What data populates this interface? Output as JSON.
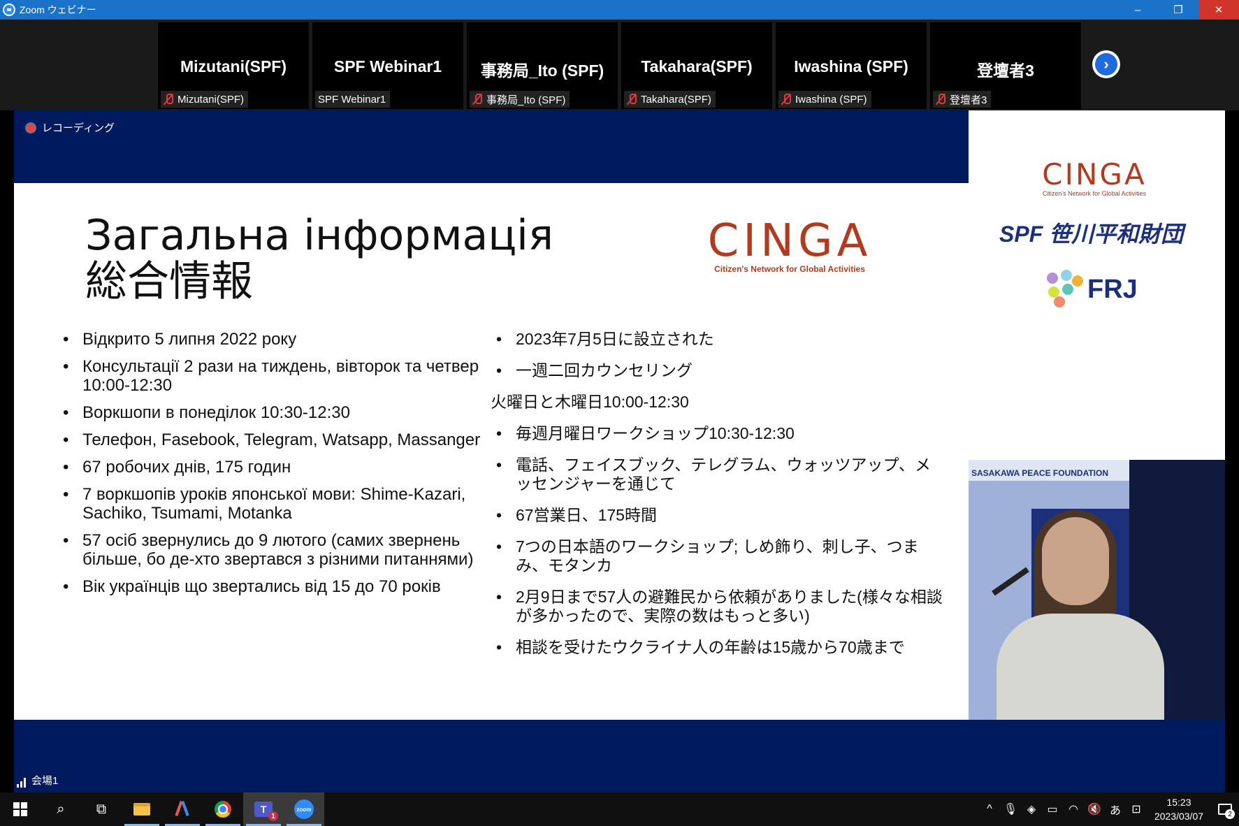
{
  "window": {
    "title": "Zoom ウェビナー",
    "minimize": "–",
    "restore": "❐",
    "close": "✕"
  },
  "participants": [
    {
      "name": "Mizutani(SPF)",
      "label": "Mizutani(SPF)",
      "muted": true
    },
    {
      "name": "SPF Webinar1",
      "label": "SPF Webinar1",
      "muted": false
    },
    {
      "name": "事務局_Ito (SPF)",
      "label": "事務局_Ito (SPF)",
      "muted": true
    },
    {
      "name": "Takahara(SPF)",
      "label": "Takahara(SPF)",
      "muted": true
    },
    {
      "name": "Iwashina (SPF)",
      "label": "Iwashina (SPF)",
      "muted": true
    },
    {
      "name": "登壇者3",
      "label": "登壇者3",
      "muted": true
    }
  ],
  "next_page": "›",
  "recording": "レコーディング",
  "slide": {
    "title_ua": "Загальна інформація",
    "title_jp": "総合情報",
    "logo": "CINGA",
    "logo_sub": "Citizen's Network for Global Activities",
    "left_bullets": [
      "Відкрито 5 липня 2022 року",
      "Консультації 2 рази на тиждень, вівторок та четвер 10:00-12:30",
      "Воркшопи в понеділок 10:30-12:30",
      "Телефон, Fasebook, Telegram, Watsapp, Massanger",
      "67 робочих днів, 175 годин",
      "7 воркшопів уроків японської мови: Shime-Kazari, Sachiko, Tsumami, Motanka",
      "57 осіб звернулись до 9 лютого (самих звернень більше, бо де-хто звертався з різними питаннями)",
      "Вік українців що звертались від 15 до 70 років"
    ],
    "right_items": [
      {
        "text": "2023年7月5日に設立された",
        "bullet": true
      },
      {
        "text": "一週二回カウンセリング",
        "bullet": true
      },
      {
        "text": "火曜日と木曜日10:00-12:30",
        "bullet": false
      },
      {
        "text": "毎週月曜日ワークショップ10:30-12:30",
        "bullet": true
      },
      {
        "text": "電話、フェイスブック、テレグラム、ウォッツアップ、メッセンジャーを通じて",
        "bullet": true
      },
      {
        "text": "67営業日、175時間",
        "bullet": true
      },
      {
        "text": "7つの日本語のワークショップ; しめ飾り、刺し子、つまみ、モタンカ",
        "bullet": true
      },
      {
        "text": "2月9日まで57人の避難民から依頼がありました(様々な相談が多かったので、実際の数はもっと多い)",
        "bullet": true
      },
      {
        "text": "相談を受けたウクライナ人の年齢は15歳から70歳まで",
        "bullet": true
      }
    ]
  },
  "side_logos": {
    "cinga": "CINGA",
    "cinga_sub": "Citizen's Network for Global Activities",
    "spf": "SPF 笹川平和財団",
    "frj": "FRJ"
  },
  "video": {
    "banner": "SASAKAWA PEACE FOUNDATION"
  },
  "network_label": "会場1",
  "taskbar": {
    "search_icon": "⌕",
    "taskview_icon": "⧉",
    "teams_letter": "T",
    "teams_badge": "1",
    "zoom_label": "zoom",
    "tray_chevron": "^",
    "ime": "あ",
    "time": "15:23",
    "date": "2023/03/07",
    "notifications": "2"
  }
}
